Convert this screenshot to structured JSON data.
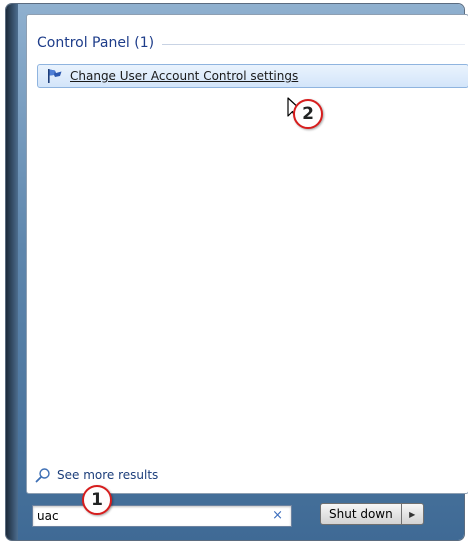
{
  "results": {
    "section_title": "Control Panel (1)",
    "items": [
      {
        "label": "Change User Account Control settings",
        "icon": "uac-flag-icon"
      }
    ],
    "see_more_label": "See more results"
  },
  "search": {
    "value": "uac",
    "clear_glyph": "×"
  },
  "shutdown": {
    "label": "Shut down",
    "arrow_glyph": "▶"
  },
  "callouts": [
    "1",
    "2"
  ],
  "colors": {
    "accent": "#1e3d8a",
    "callout_ring": "#d71d1d",
    "highlight_border": "#8fb4df"
  }
}
